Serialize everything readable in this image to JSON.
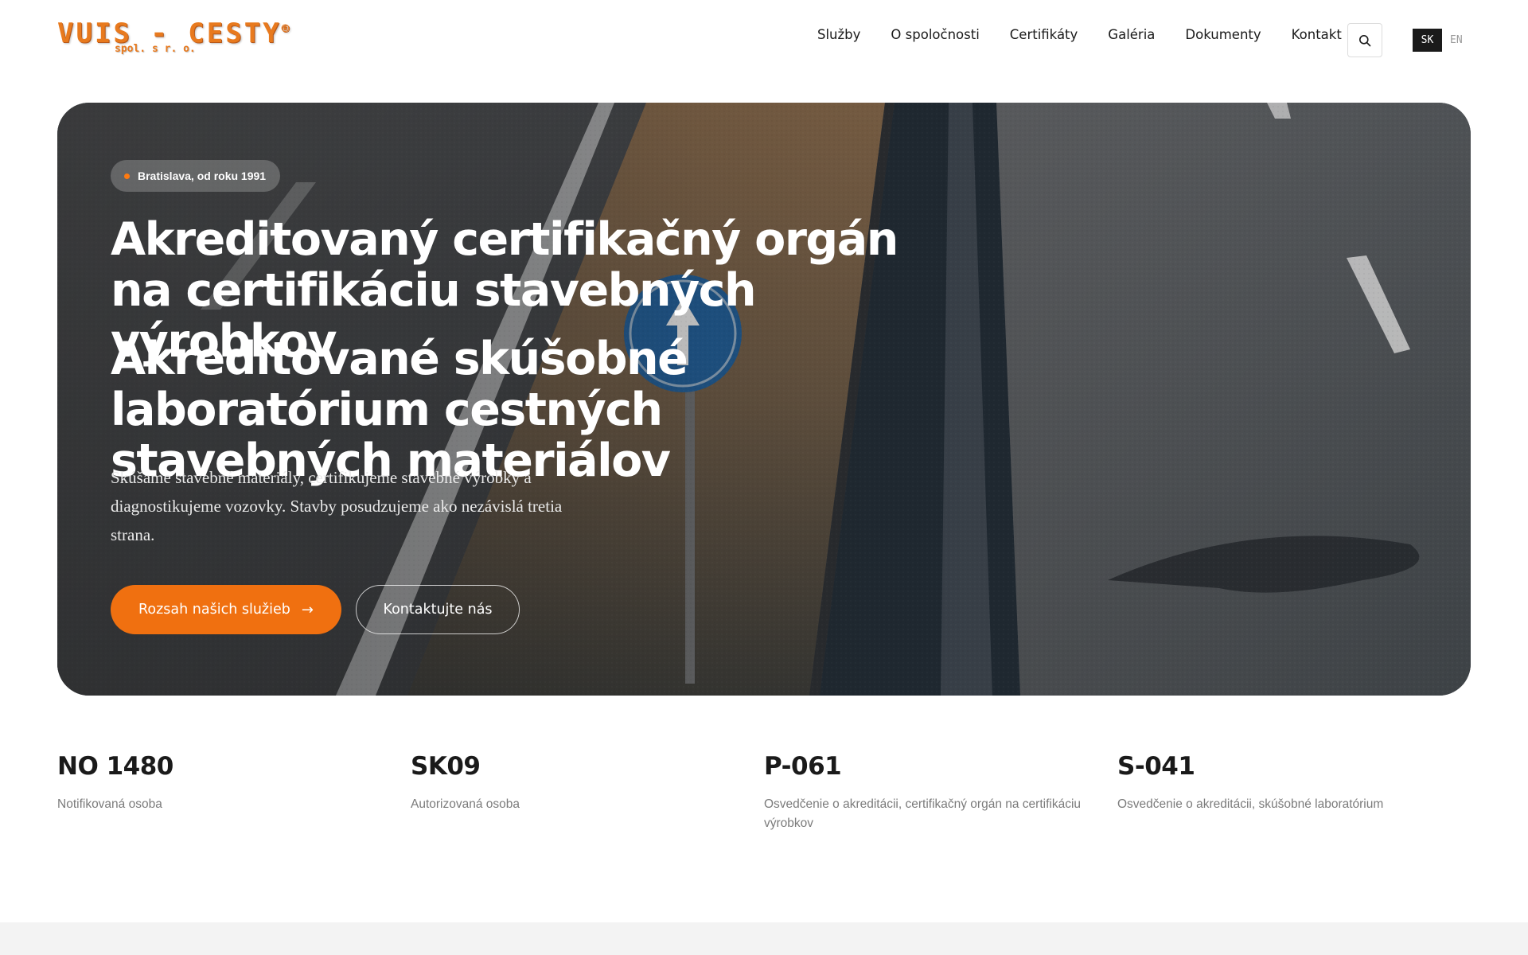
{
  "brand": {
    "name": "VUIS - CESTY",
    "registered": "®",
    "subtitle": "spol. s r. o."
  },
  "nav": {
    "items": [
      {
        "label": "Služby"
      },
      {
        "label": "O spoločnosti"
      },
      {
        "label": "Certifikáty"
      },
      {
        "label": "Galéria"
      },
      {
        "label": "Dokumenty"
      },
      {
        "label": "Kontakt"
      }
    ],
    "search_icon": "search-icon"
  },
  "language": {
    "active": "SK",
    "inactive": "EN"
  },
  "hero": {
    "badge": "Bratislava, od roku 1991",
    "heading_1": "Akreditovaný certifikačný orgán na certifikáciu stavebných výrobkov",
    "heading_2": "Akreditované skúšobné laboratórium cestných stavebných materiálov",
    "description": "Skúšame stavebné materiály, certifikujeme stavebné výrobky a diagnostikujeme vozovky. Stavby posudzujeme ako nezávislá tretia strana.",
    "primary_button": "Rozsah našich služieb",
    "primary_button_icon": "arrow-right-icon",
    "secondary_button": "Kontaktujte nás"
  },
  "stats": [
    {
      "code": "NO 1480",
      "label": "Notifikovaná osoba"
    },
    {
      "code": "SK09",
      "label": "Autorizovaná osoba"
    },
    {
      "code": "P-061",
      "label": "Osvedčenie o akreditácii, certifikačný orgán na certifikáciu výrobkov"
    },
    {
      "code": "S-041",
      "label": "Osvedčenie o akreditácii, skúšobné laboratórium"
    }
  ],
  "colors": {
    "accent": "#f07010",
    "logo": "#e87a1e",
    "text": "#1a1a1a",
    "muted": "#7b7b7b"
  }
}
